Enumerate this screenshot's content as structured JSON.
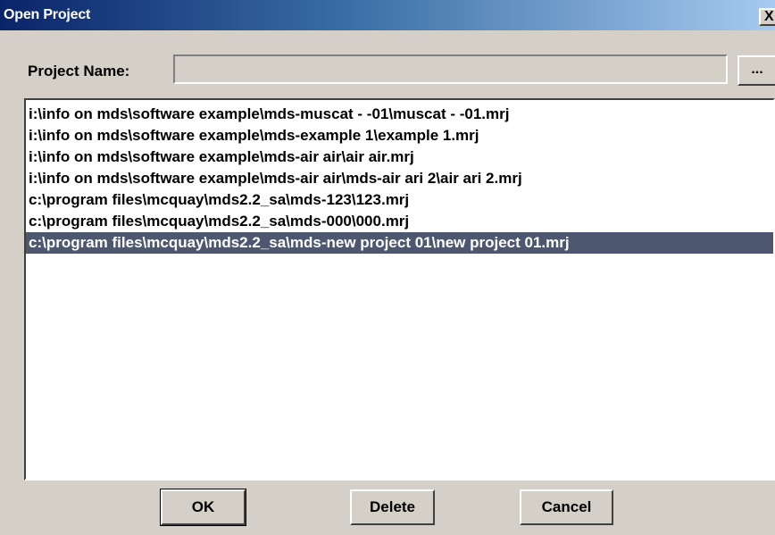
{
  "window": {
    "title": "Open Project",
    "close_label": "X"
  },
  "project_name": {
    "label": "Project Name:",
    "value": "",
    "browse_label": "..."
  },
  "projects": {
    "items": [
      "i:\\info on mds\\software example\\mds-muscat - -01\\muscat - -01.mrj",
      "i:\\info on mds\\software example\\mds-example 1\\example 1.mrj",
      "i:\\info on mds\\software example\\mds-air air\\air air.mrj",
      "i:\\info on mds\\software example\\mds-air air\\mds-air ari 2\\air ari 2.mrj",
      "c:\\program files\\mcquay\\mds2.2_sa\\mds-123\\123.mrj",
      "c:\\program files\\mcquay\\mds2.2_sa\\mds-000\\000.mrj",
      "c:\\program files\\mcquay\\mds2.2_sa\\mds-new project 01\\new project 01.mrj"
    ],
    "selected_index": 6
  },
  "buttons": {
    "ok": "OK",
    "delete": "Delete",
    "cancel": "Cancel"
  },
  "colors": {
    "selection_bg": "#4d5870",
    "title_start": "#0a246a",
    "title_end": "#a6caf0"
  }
}
